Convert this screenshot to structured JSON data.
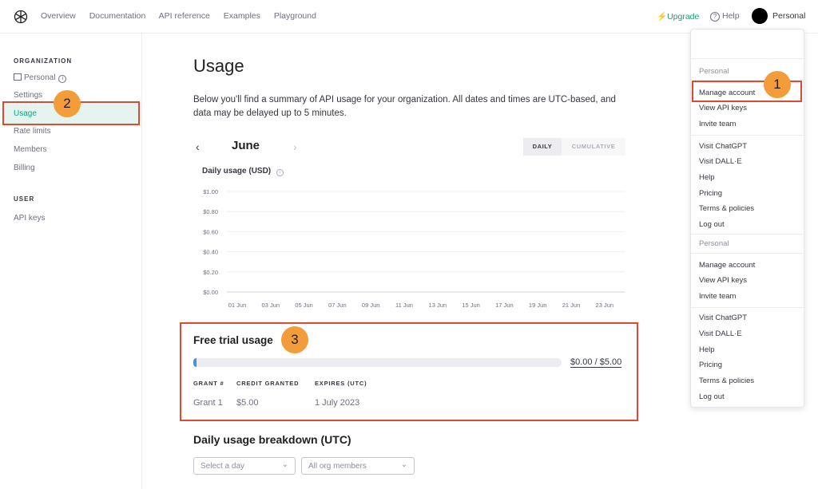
{
  "nav": {
    "links": [
      "Overview",
      "Documentation",
      "API reference",
      "Examples",
      "Playground"
    ],
    "upgrade": "Upgrade",
    "help": "Help",
    "account": "Personal"
  },
  "sidebar": {
    "org_heading": "ORGANIZATION",
    "org_name": "Personal",
    "items": [
      "Settings",
      "Usage",
      "Rate limits",
      "Members",
      "Billing"
    ],
    "active_item": "Usage",
    "user_heading": "USER",
    "user_items": [
      "API keys"
    ]
  },
  "main": {
    "title": "Usage",
    "summary": "Below you'll find a summary of API usage for your organization. All dates and times are UTC-based, and data may be delayed up to 5 minutes.",
    "month": "June",
    "toggle": {
      "daily": "DAILY",
      "cumulative": "CUMULATIVE",
      "selected": "DAILY"
    }
  },
  "chart_data": {
    "type": "bar",
    "title": "Daily usage (USD)",
    "ylabel": "",
    "xlabel": "",
    "y_ticks": [
      "$1.00",
      "$0.80",
      "$0.60",
      "$0.40",
      "$0.20",
      "$0.00"
    ],
    "x_ticks": [
      "01 Jun",
      "03 Jun",
      "05 Jun",
      "07 Jun",
      "09 Jun",
      "11 Jun",
      "13 Jun",
      "15 Jun",
      "17 Jun",
      "19 Jun",
      "21 Jun",
      "23 Jun"
    ],
    "ylim": [
      0,
      1.0
    ],
    "values": [],
    "grid": true
  },
  "free_trial": {
    "title": "Free trial usage",
    "used": 0.0,
    "total": 5.0,
    "label": "$0.00 / $5.00",
    "columns": [
      "GRANT #",
      "CREDIT GRANTED",
      "EXPIRES (UTC)"
    ],
    "rows": [
      [
        "Grant 1",
        "$5.00",
        "1 July 2023"
      ]
    ]
  },
  "breakdown": {
    "title": "Daily usage breakdown (UTC)",
    "day_placeholder": "Select a day",
    "members_value": "All org members"
  },
  "dropdown": {
    "sections": [
      {
        "header": "Personal",
        "items": [
          "Manage account",
          "View API keys",
          "Invite team"
        ]
      },
      {
        "header": "",
        "items": [
          "Visit ChatGPT",
          "Visit DALL·E",
          "Help",
          "Pricing",
          "Terms & policies",
          "Log out"
        ]
      },
      {
        "header": "Personal",
        "items": [
          "Manage account",
          "View API keys",
          "Invite team"
        ]
      },
      {
        "header": "",
        "items": [
          "Visit ChatGPT",
          "Visit DALL·E",
          "Help",
          "Pricing",
          "Terms & policies",
          "Log out"
        ]
      }
    ]
  },
  "callouts": [
    "1",
    "2",
    "3"
  ],
  "colors": {
    "accent": "#10a37f",
    "highlight": "#e0492d",
    "callout": "#f39c3a"
  }
}
